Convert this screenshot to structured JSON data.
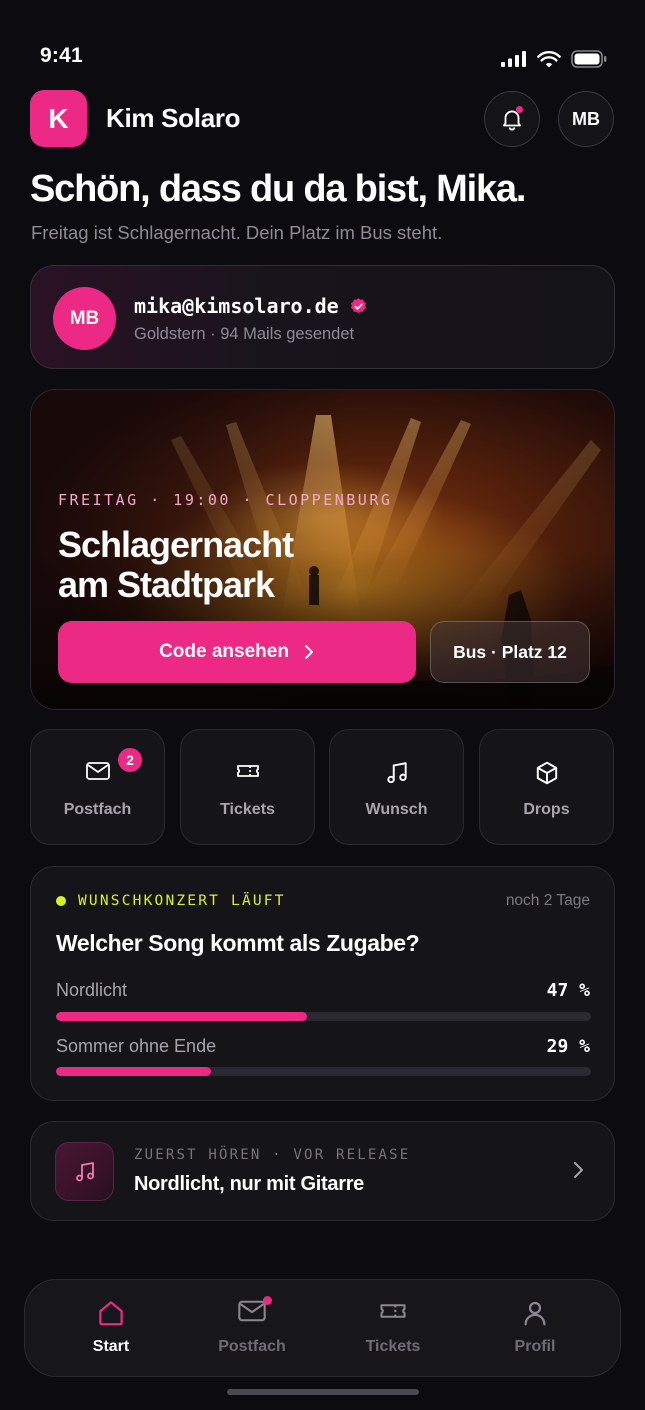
{
  "status": {
    "time": "9:41"
  },
  "header": {
    "logo_letter": "K",
    "brand": "Kim Solaro",
    "avatar_initials": "MB"
  },
  "greeting": {
    "title": "Schön, dass du da bist, Mika.",
    "subtitle": "Freitag ist Schlagernacht. Dein Platz im Bus steht."
  },
  "account": {
    "initials": "MB",
    "email": "mika@kimsolaro.de",
    "meta": "Goldstern · 94 Mails gesendet"
  },
  "hero": {
    "kicker": "FREITAG · 19:00 · CLOPPENBURG",
    "title_line1": "Schlagernacht",
    "title_line2": "am Stadtpark",
    "primary_label": "Code ansehen",
    "secondary_label": "Bus · Platz 12"
  },
  "tiles": [
    {
      "label": "Postfach",
      "icon": "mail-icon",
      "badge": "2"
    },
    {
      "label": "Tickets",
      "icon": "ticket-icon"
    },
    {
      "label": "Wunsch",
      "icon": "music-note-icon"
    },
    {
      "label": "Drops",
      "icon": "package-icon"
    }
  ],
  "poll": {
    "kicker": "WUNSCHKONZERT LÄUFT",
    "remaining": "noch 2 Tage",
    "question": "Welcher Song kommt als Zugabe?",
    "options": [
      {
        "label": "Nordlicht",
        "percent_text": "47 %",
        "percent": 47
      },
      {
        "label": "Sommer ohne Ende",
        "percent_text": "29 %",
        "percent": 29
      }
    ]
  },
  "release": {
    "kicker": "ZUERST HÖREN · VOR RELEASE",
    "title": "Nordlicht, nur mit Gitarre"
  },
  "nav": [
    {
      "label": "Start",
      "icon": "home-icon",
      "active": true
    },
    {
      "label": "Postfach",
      "icon": "mail-icon",
      "dot": true
    },
    {
      "label": "Tickets",
      "icon": "ticket-icon"
    },
    {
      "label": "Profil",
      "icon": "user-icon"
    }
  ],
  "colors": {
    "accent": "#ec2a85",
    "live": "#d7f31e",
    "background": "#0c0b0f",
    "card": "#151419"
  }
}
